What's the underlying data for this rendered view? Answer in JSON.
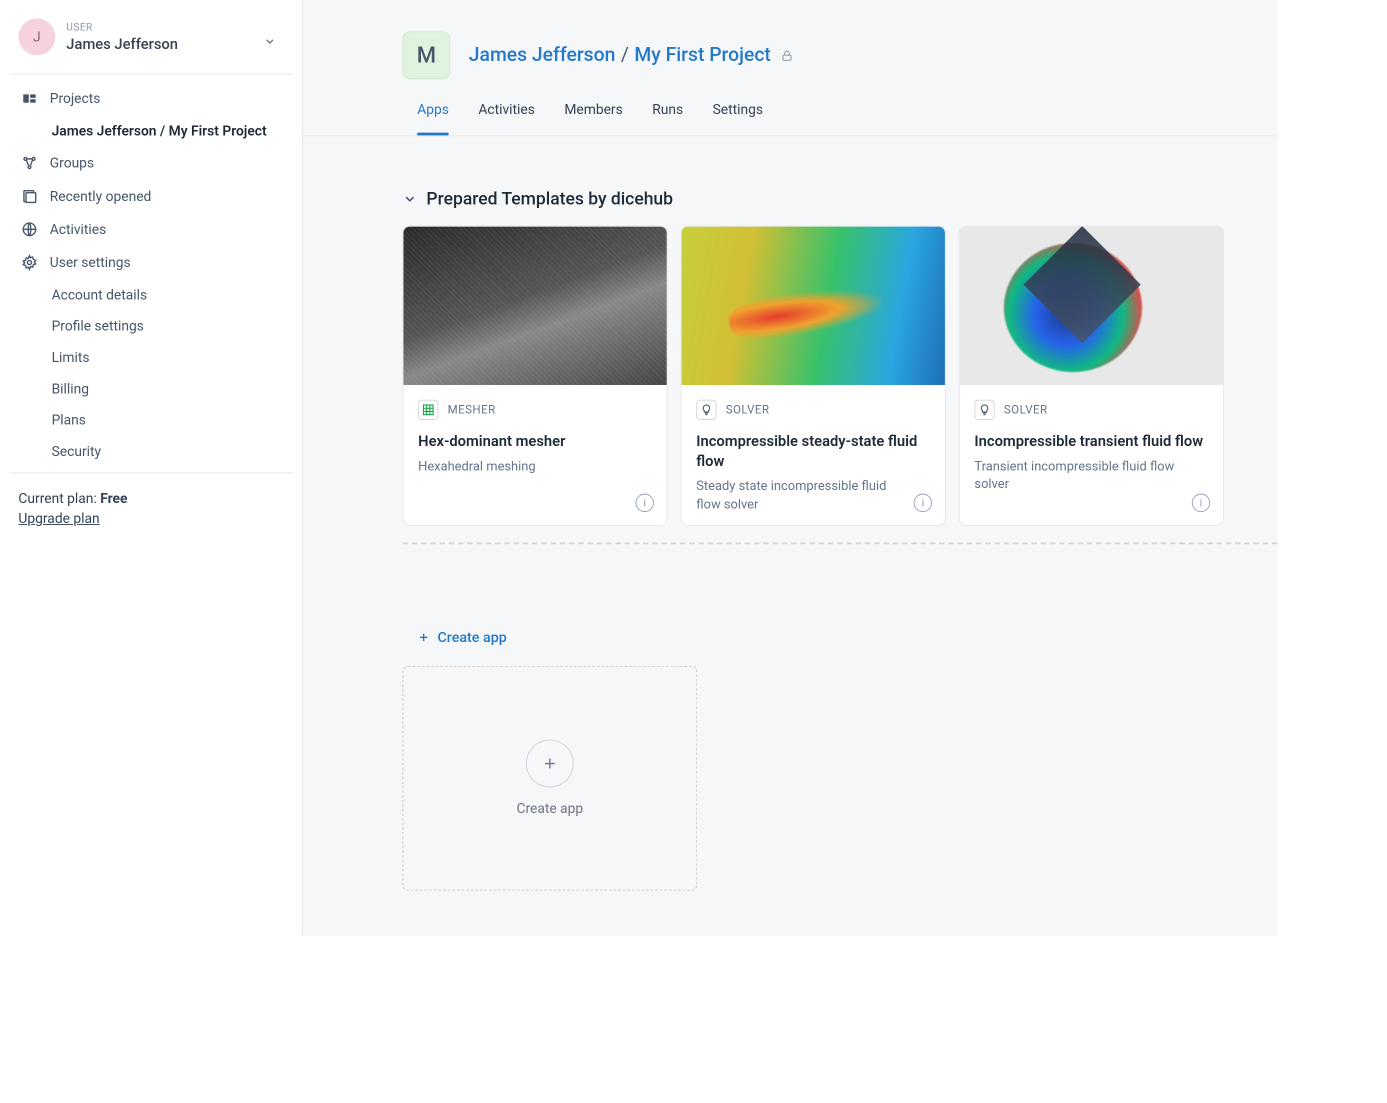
{
  "user": {
    "label": "USER",
    "name": "James Jefferson",
    "avatar_letter": "J"
  },
  "sidebar": {
    "items": [
      {
        "id": "projects",
        "label": "Projects"
      },
      {
        "id": "groups",
        "label": "Groups"
      },
      {
        "id": "recent",
        "label": "Recently opened"
      },
      {
        "id": "activities",
        "label": "Activities"
      },
      {
        "id": "settings",
        "label": "User settings"
      }
    ],
    "active_project": "James Jefferson / My First Project",
    "settings_children": [
      {
        "id": "account",
        "label": "Account details"
      },
      {
        "id": "profile",
        "label": "Profile settings"
      },
      {
        "id": "limits",
        "label": "Limits"
      },
      {
        "id": "billing",
        "label": "Billing"
      },
      {
        "id": "plans",
        "label": "Plans"
      },
      {
        "id": "security",
        "label": "Security"
      }
    ]
  },
  "plan": {
    "label": "Current plan: ",
    "name": "Free",
    "upgrade": "Upgrade plan"
  },
  "breadcrumb": {
    "badge": "M",
    "user": "James Jefferson",
    "sep": "/",
    "project": "My First Project"
  },
  "tabs": [
    {
      "id": "apps",
      "label": "Apps",
      "active": true
    },
    {
      "id": "activities",
      "label": "Activities"
    },
    {
      "id": "members",
      "label": "Members"
    },
    {
      "id": "runs",
      "label": "Runs"
    },
    {
      "id": "settings",
      "label": "Settings"
    }
  ],
  "templates": {
    "title": "Prepared Templates by dicehub",
    "cards": [
      {
        "type_label": "MESHER",
        "type_icon": "grid-icon",
        "title": "Hex-dominant mesher",
        "desc": "Hexahedral meshing"
      },
      {
        "type_label": "SOLVER",
        "type_icon": "bulb-icon",
        "title": "Incompressible steady-state fluid flow",
        "desc": "Steady state incompressible fluid flow solver"
      },
      {
        "type_label": "SOLVER",
        "type_icon": "bulb-icon",
        "title": "Incompressible transient fluid flow",
        "desc": "Transient incompressible fluid flow solver"
      }
    ]
  },
  "create": {
    "link": "Create app",
    "card_label": "Create app"
  }
}
